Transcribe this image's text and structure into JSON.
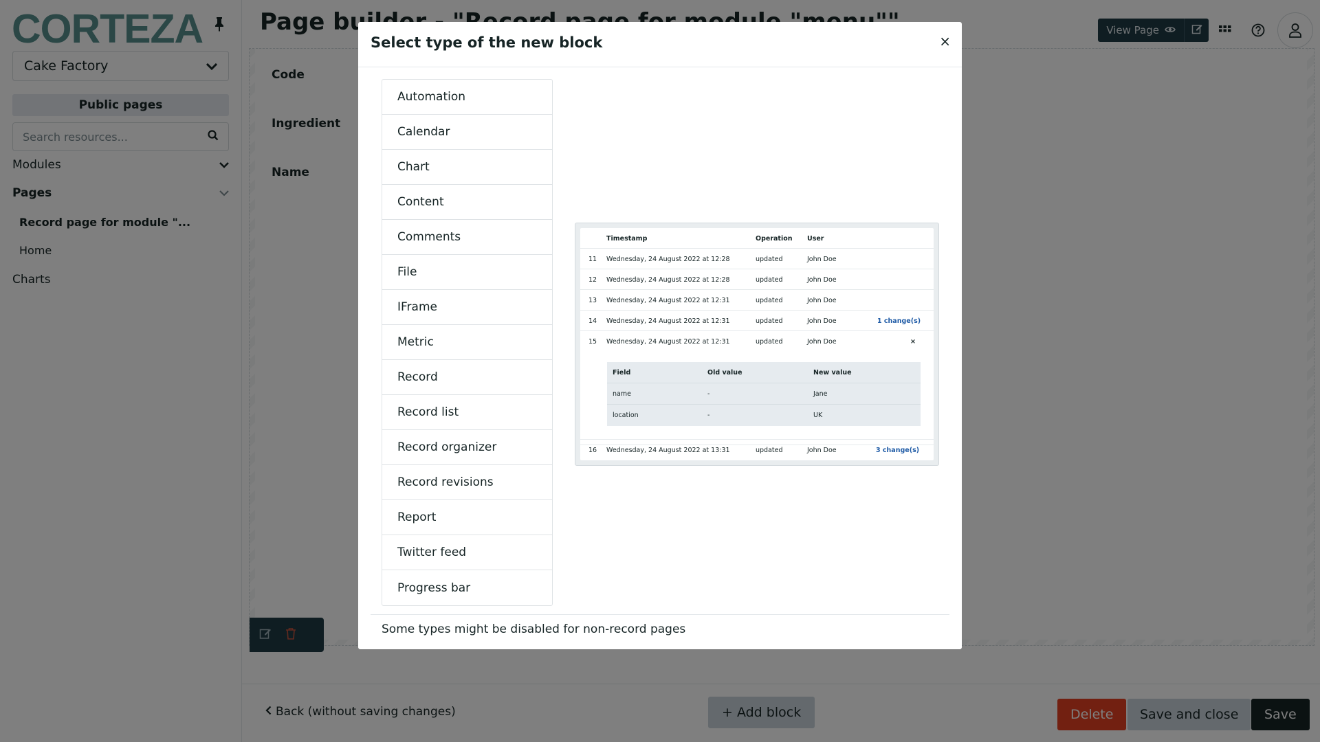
{
  "sidebar": {
    "logo": "CORTEZA",
    "namespace": "Cake Factory",
    "public_pages": "Public pages",
    "search_placeholder": "Search resources...",
    "modules_label": "Modules",
    "pages_label": "Pages",
    "page_items": [
      "Record page for module \"...",
      "Home"
    ],
    "charts_label": "Charts"
  },
  "header": {
    "title": "Page builder - \"Record page for module \"menu\"\"",
    "view_page": "View Page"
  },
  "canvas": {
    "fields": [
      "Code",
      "Ingredient",
      "Name"
    ]
  },
  "footer": {
    "back": "Back (without saving changes)",
    "add_block": "+ Add block",
    "delete": "Delete",
    "save_close": "Save and close",
    "save": "Save"
  },
  "modal": {
    "title": "Select type of the new block",
    "close": "×",
    "types": [
      "Automation",
      "Calendar",
      "Chart",
      "Content",
      "Comments",
      "File",
      "IFrame",
      "Metric",
      "Record",
      "Record list",
      "Record organizer",
      "Record revisions",
      "Report",
      "Twitter feed",
      "Progress bar"
    ],
    "note": "Some types might be disabled for non-record pages",
    "preview": {
      "headers": [
        "Timestamp",
        "Operation",
        "User"
      ],
      "rows": [
        {
          "n": "11",
          "ts": "Wednesday, 24 August 2022 at 12:28",
          "op": "updated",
          "user": "John Doe",
          "extra": ""
        },
        {
          "n": "12",
          "ts": "Wednesday, 24 August 2022 at 12:28",
          "op": "updated",
          "user": "John Doe",
          "extra": ""
        },
        {
          "n": "13",
          "ts": "Wednesday, 24 August 2022 at 12:31",
          "op": "updated",
          "user": "John Doe",
          "extra": ""
        },
        {
          "n": "14",
          "ts": "Wednesday, 24 August 2022 at 12:31",
          "op": "updated",
          "user": "John Doe",
          "extra": "1 change(s)"
        },
        {
          "n": "15",
          "ts": "Wednesday, 24 August 2022 at 12:31",
          "op": "updated",
          "user": "John Doe",
          "extra": "×"
        },
        {
          "n": "16",
          "ts": "Wednesday, 24 August 2022 at 13:31",
          "op": "updated",
          "user": "John Doe",
          "extra": "3 change(s)"
        }
      ],
      "sub_headers": [
        "Field",
        "Old value",
        "New value"
      ],
      "sub_rows": [
        {
          "field": "name",
          "old": "-",
          "new": "Jane"
        },
        {
          "field": "location",
          "old": "-",
          "new": "UK"
        }
      ]
    }
  }
}
